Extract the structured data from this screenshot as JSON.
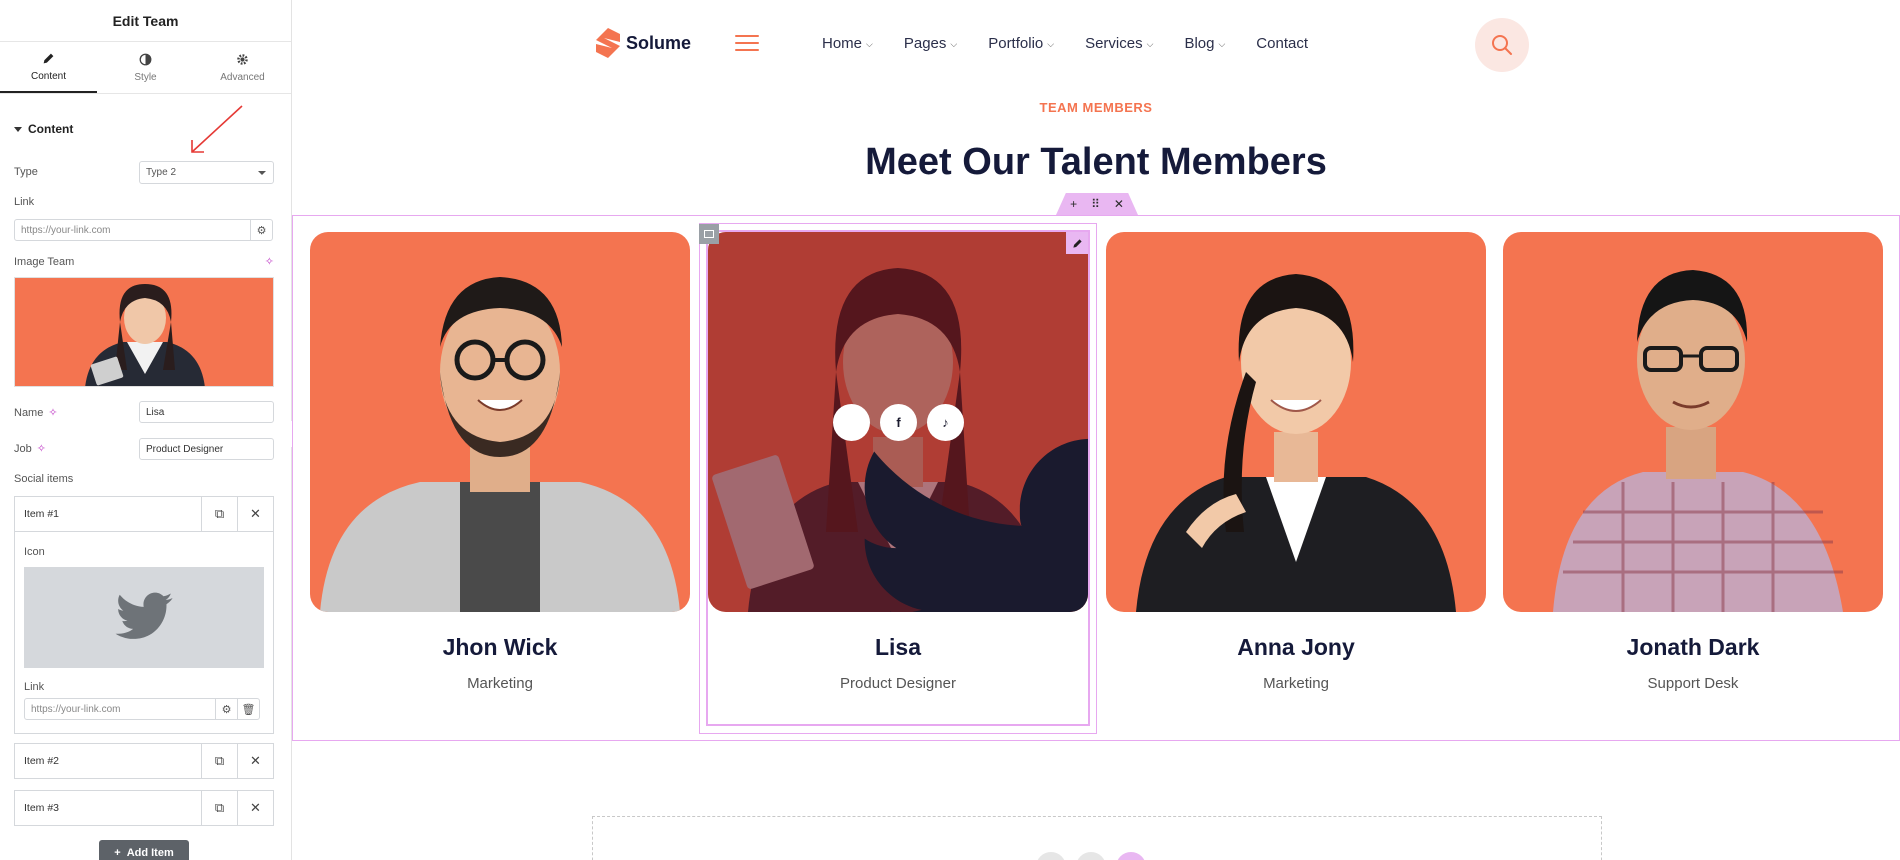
{
  "panel": {
    "title": "Edit Team",
    "tabs": [
      {
        "label": "Content",
        "icon": "pencil-icon"
      },
      {
        "label": "Style",
        "icon": "contrast-icon"
      },
      {
        "label": "Advanced",
        "icon": "gear-icon"
      }
    ],
    "section_title": "Content",
    "type_label": "Type",
    "type_value": "Type 2",
    "link_label": "Link",
    "link_placeholder": "https://your-link.com",
    "image_label": "Image Team",
    "name_label": "Name",
    "name_value": "Lisa",
    "job_label": "Job",
    "job_value": "Product Designer",
    "social_label": "Social items",
    "items": [
      {
        "title": "Item #1"
      },
      {
        "title": "Item #2"
      },
      {
        "title": "Item #3"
      }
    ],
    "icon_label": "Icon",
    "item_link_label": "Link",
    "item_link_placeholder": "https://your-link.com",
    "add_item_label": "Add Item"
  },
  "site": {
    "logo_text": "Solume",
    "nav": [
      {
        "label": "Home",
        "dropdown": true
      },
      {
        "label": "Pages",
        "dropdown": true
      },
      {
        "label": "Portfolio",
        "dropdown": true
      },
      {
        "label": "Services",
        "dropdown": true
      },
      {
        "label": "Blog",
        "dropdown": true
      },
      {
        "label": "Contact",
        "dropdown": false
      }
    ],
    "eyebrow": "TEAM MEMBERS",
    "heading": "Meet Our Talent Members",
    "members": [
      {
        "name": "Jhon Wick",
        "job": "Marketing"
      },
      {
        "name": "Lisa",
        "job": "Product Designer"
      },
      {
        "name": "Anna Jony",
        "job": "Marketing"
      },
      {
        "name": "Jonath Dark",
        "job": "Support Desk"
      }
    ],
    "social_icons": [
      "twitter-icon",
      "facebook-icon",
      "tiktok-icon"
    ]
  },
  "colors": {
    "accent": "#f47450",
    "heading": "#151a3a",
    "editor_outline": "#e7a8f0"
  }
}
